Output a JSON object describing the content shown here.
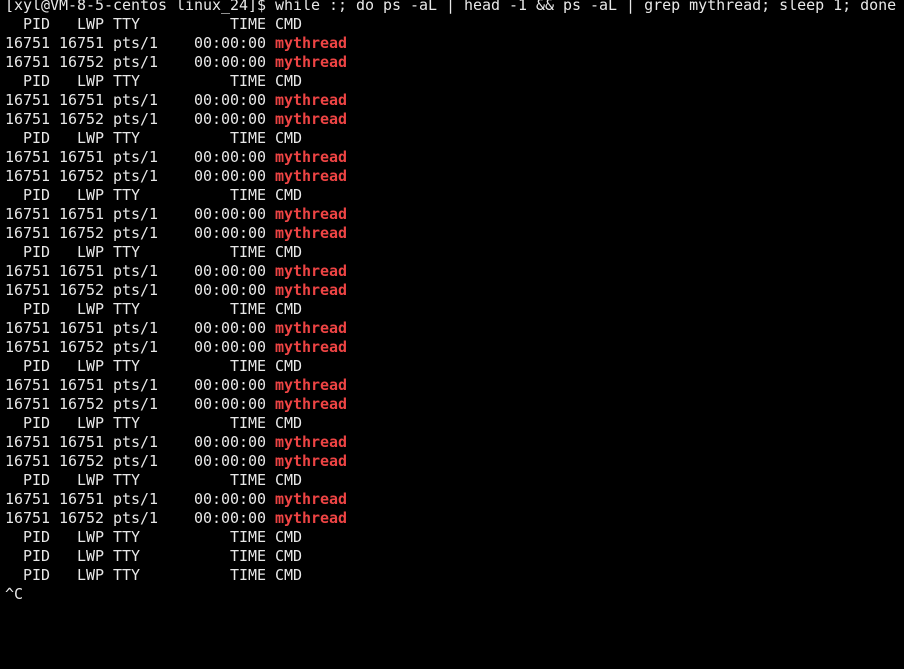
{
  "terminal": {
    "prompt": "[xyl@VM-8-5-centos linux_24]$ ",
    "command": "while :; do ps -aL | head -1 && ps -aL | grep mythread; sleep 1; done",
    "header": "  PID   LWP TTY          TIME CMD",
    "process_rows": [
      {
        "prefix": "16751 16751 pts/1    00:00:00 ",
        "cmd": "mythread"
      },
      {
        "prefix": "16751 16752 pts/1    00:00:00 ",
        "cmd": "mythread"
      }
    ],
    "iterations_with_threads": 9,
    "iterations_empty": 3,
    "interrupt": "^C",
    "colors": {
      "background": "#000000",
      "text": "#e8e8e8",
      "grep_match": "#ee4444"
    }
  }
}
